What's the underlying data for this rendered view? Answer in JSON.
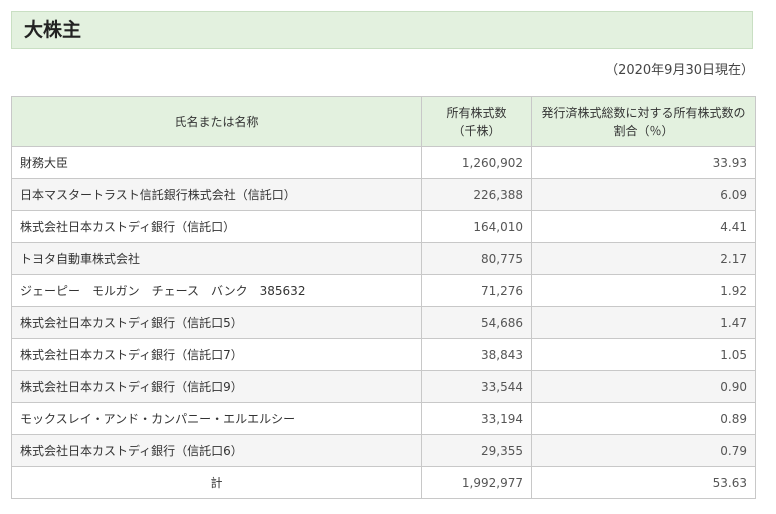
{
  "title": "大株主",
  "as_of": "（2020年9月30日現在）",
  "table": {
    "headers": {
      "name": "氏名または名称",
      "shares_line1": "所有株式数",
      "shares_line2": "（千株）",
      "ratio_line1": "発行済株式総数に対する所有株式数の",
      "ratio_line2": "割合（％）"
    },
    "rows": [
      {
        "name": "財務大臣",
        "shares": "1,260,902",
        "ratio": "33.93"
      },
      {
        "name": "日本マスタートラスト信託銀行株式会社（信託口）",
        "shares": "226,388",
        "ratio": "6.09"
      },
      {
        "name": "株式会社日本カストディ銀行（信託口）",
        "shares": "164,010",
        "ratio": "4.41"
      },
      {
        "name": "トヨタ自動車株式会社",
        "shares": "80,775",
        "ratio": "2.17"
      },
      {
        "name": "ジェーピー　モルガン　チェース　バンク　385632",
        "shares": "71,276",
        "ratio": "1.92"
      },
      {
        "name": "株式会社日本カストディ銀行（信託口5）",
        "shares": "54,686",
        "ratio": "1.47"
      },
      {
        "name": "株式会社日本カストディ銀行（信託口7）",
        "shares": "38,843",
        "ratio": "1.05"
      },
      {
        "name": "株式会社日本カストディ銀行（信託口9）",
        "shares": "33,544",
        "ratio": "0.90"
      },
      {
        "name": "モックスレイ・アンド・カンパニー・エルエルシー",
        "shares": "33,194",
        "ratio": "0.89"
      },
      {
        "name": "株式会社日本カストディ銀行（信託口6）",
        "shares": "29,355",
        "ratio": "0.79"
      }
    ],
    "total": {
      "label": "計",
      "shares": "1,992,977",
      "ratio": "53.63"
    }
  }
}
